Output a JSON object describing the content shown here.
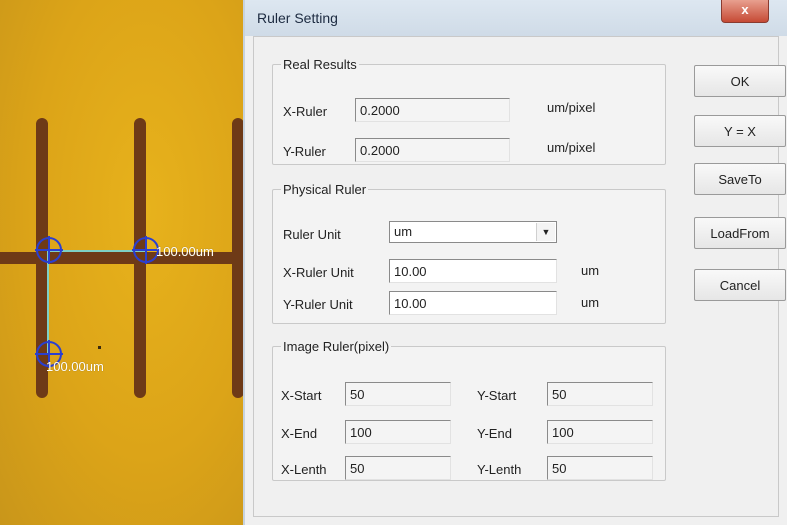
{
  "image": {
    "measurement_horizontal": "100.00um",
    "measurement_vertical": "100.00um"
  },
  "dialog": {
    "title": "Ruler Setting",
    "close_label": "x",
    "real_results": {
      "legend": "Real Results",
      "x_label": "X-Ruler",
      "x_value": "0.2000",
      "x_unit": "um/pixel",
      "y_label": "Y-Ruler",
      "y_value": "0.2000",
      "y_unit": "um/pixel"
    },
    "physical_ruler": {
      "legend": "Physical Ruler",
      "unit_label": "Ruler Unit",
      "unit_value": "um",
      "x_label": "X-Ruler Unit",
      "x_value": "10.00",
      "x_unit": "um",
      "y_label": "Y-Ruler Unit",
      "y_value": "10.00",
      "y_unit": "um"
    },
    "image_ruler": {
      "legend": "Image Ruler(pixel)",
      "x_start_label": "X-Start",
      "x_start": "50",
      "y_start_label": "Y-Start",
      "y_start": "50",
      "x_end_label": "X-End",
      "x_end": "100",
      "y_end_label": "Y-End",
      "y_end": "100",
      "x_length_label": "X-Lenth",
      "x_length": "50",
      "y_length_label": "Y-Lenth",
      "y_length": "50"
    },
    "buttons": {
      "ok": "OK",
      "y_eq_x": "Y = X",
      "save_to": "SaveTo",
      "load_from": "LoadFrom",
      "cancel": "Cancel"
    }
  }
}
